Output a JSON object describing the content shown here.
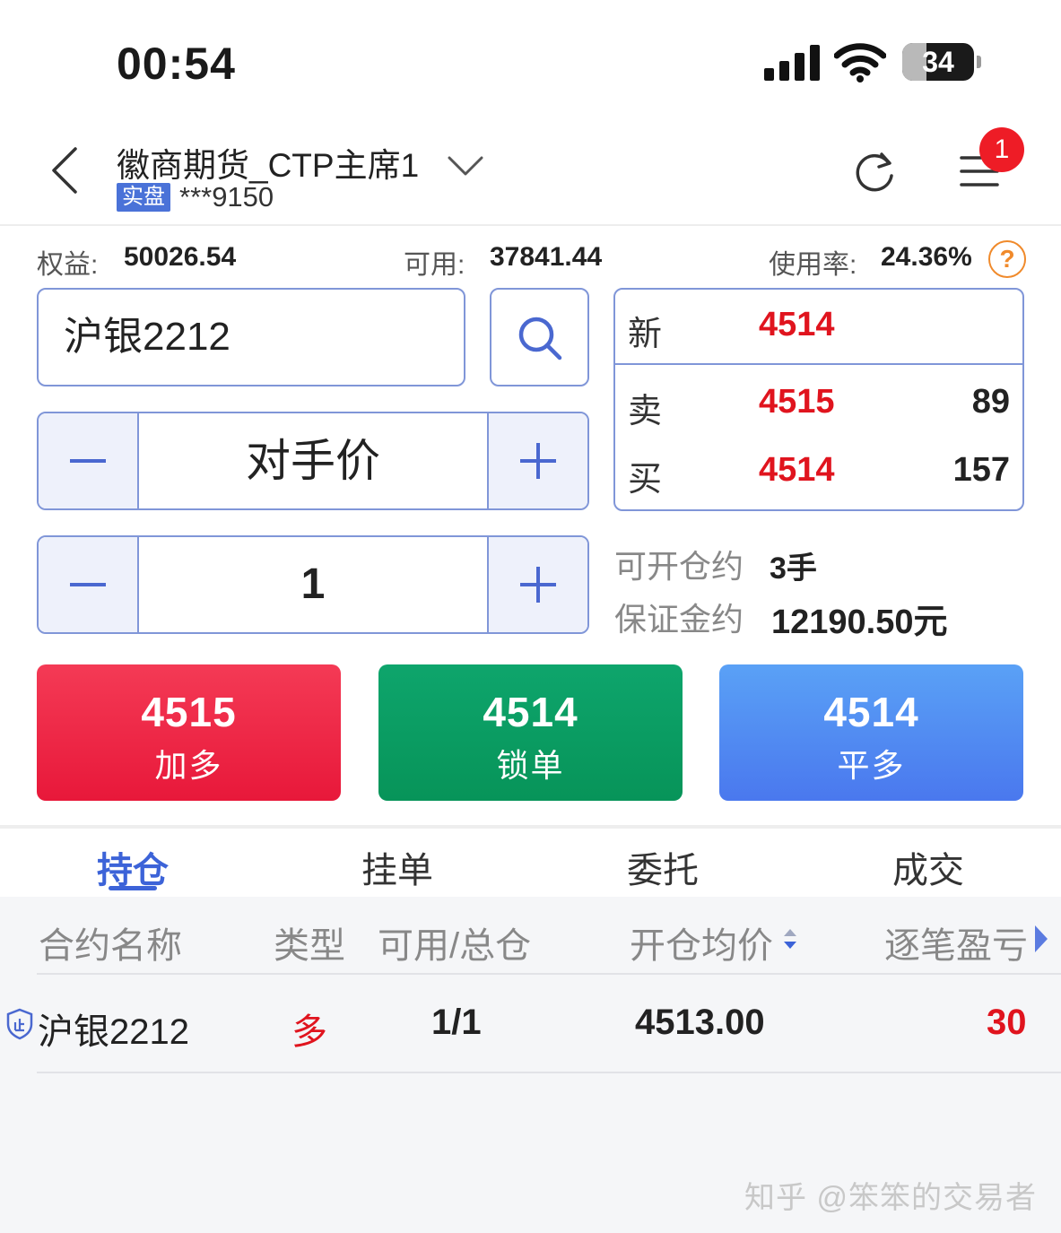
{
  "status_bar": {
    "time": "00:54",
    "battery_percent": 34,
    "battery_label": "34"
  },
  "header": {
    "account_name": "徽商期货_CTP主席1",
    "account_type": "实盘",
    "account_id": "***9150",
    "notification_count": "1"
  },
  "summary": {
    "equity_label": "权益:",
    "equity_value": "50026.54",
    "available_label": "可用:",
    "available_value": "37841.44",
    "usage_label": "使用率:",
    "usage_value": "24.36%",
    "help_symbol": "?"
  },
  "order_form": {
    "contract": "沪银2212",
    "price_type": "对手价",
    "quantity": "1"
  },
  "quote": {
    "last_label": "新",
    "last_price": "4514",
    "ask_label": "卖",
    "ask_price": "4515",
    "ask_volume": "89",
    "bid_label": "买",
    "bid_price": "4514",
    "bid_volume": "157"
  },
  "margin_info": {
    "openable_label": "可开仓约",
    "openable_value": "3手",
    "margin_label": "保证金约",
    "margin_value": "12190.50元"
  },
  "actions": [
    {
      "price": "4515",
      "label": "加多",
      "color": "#ed2442"
    },
    {
      "price": "4514",
      "label": "锁单",
      "color": "#0a9c62"
    },
    {
      "price": "4514",
      "label": "平多",
      "color": "#5089f2"
    }
  ],
  "tabs": [
    {
      "label": "持仓",
      "active": true
    },
    {
      "label": "挂单",
      "active": false
    },
    {
      "label": "委托",
      "active": false
    },
    {
      "label": "成交",
      "active": false
    }
  ],
  "positions": {
    "columns": [
      "合约名称",
      "类型",
      "可用/总仓",
      "开仓均价",
      "逐笔盈亏"
    ],
    "rows": [
      {
        "contract": "沪银2212",
        "type": "多",
        "available_total": "1/1",
        "avg_open_price": "4513.00",
        "pnl": "30"
      }
    ]
  },
  "watermark": "知乎 @笨笨的交易者",
  "colors": {
    "accent": "#3c63d8",
    "price_red": "#e0141e",
    "badge_red": "#ee1c26",
    "help_orange": "#f08a2b"
  }
}
